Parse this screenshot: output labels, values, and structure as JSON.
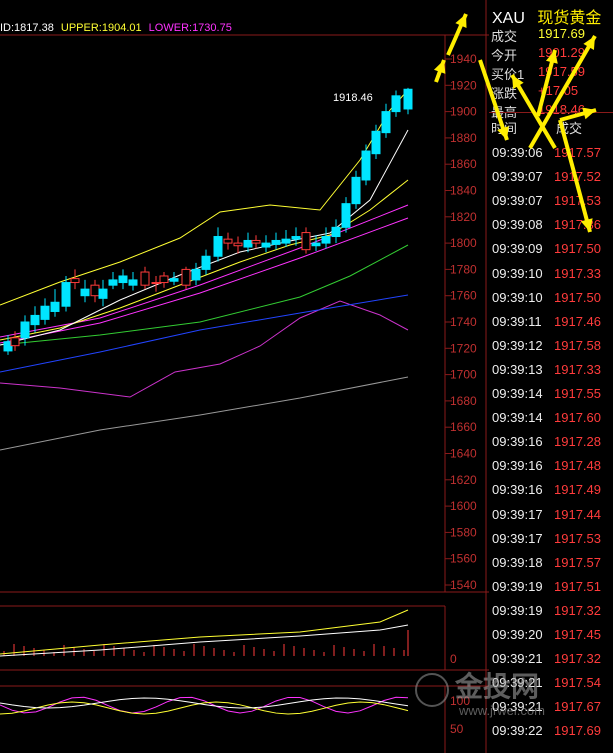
{
  "indicator": {
    "mid": "ID:1817.38",
    "upper": "UPPER:1904.01",
    "lower": "LOWER:1730.75",
    "mid_color": "#ffffff",
    "upper_color": "#ffff33",
    "lower_color": "#ff33ff"
  },
  "price_axis": [
    "1940",
    "1920",
    "1900",
    "1880",
    "1860",
    "1840",
    "1820",
    "1800",
    "1780",
    "1760",
    "1740",
    "1720",
    "1700",
    "1680",
    "1660",
    "1640",
    "1620",
    "1600",
    "1580",
    "1560",
    "1540"
  ],
  "volume_axis": [
    "0"
  ],
  "osc_axis": [
    "100",
    "50"
  ],
  "peak_label": "1918.46",
  "symbol": {
    "code": "XAU",
    "name": "现货黄金"
  },
  "quote": [
    {
      "label": "成交",
      "value": "1917.69",
      "color": "#ffff33"
    },
    {
      "label": "今开",
      "value": "1901.29",
      "color": "#ff3b3b"
    },
    {
      "label": "买价1",
      "value": "1917.59",
      "color": "#ff3b3b"
    },
    {
      "label": "涨跌",
      "value": "+17.05",
      "color": "#ff3b3b"
    },
    {
      "label": "最高",
      "value": "1918.46",
      "color": "#ff3b3b"
    }
  ],
  "ticks_header": {
    "time": "时间",
    "price": "成交"
  },
  "ticks": [
    {
      "time": "09:39:06",
      "price": "1917.57"
    },
    {
      "time": "09:39:07",
      "price": "1917.52"
    },
    {
      "time": "09:39:07",
      "price": "1917.53"
    },
    {
      "time": "09:39:08",
      "price": "1917.36"
    },
    {
      "time": "09:39:09",
      "price": "1917.50"
    },
    {
      "time": "09:39:10",
      "price": "1917.33"
    },
    {
      "time": "09:39:10",
      "price": "1917.50"
    },
    {
      "time": "09:39:11",
      "price": "1917.46"
    },
    {
      "time": "09:39:12",
      "price": "1917.58"
    },
    {
      "time": "09:39:13",
      "price": "1917.33"
    },
    {
      "time": "09:39:14",
      "price": "1917.55"
    },
    {
      "time": "09:39:14",
      "price": "1917.60"
    },
    {
      "time": "09:39:16",
      "price": "1917.28"
    },
    {
      "time": "09:39:16",
      "price": "1917.48"
    },
    {
      "time": "09:39:16",
      "price": "1917.49"
    },
    {
      "time": "09:39:17",
      "price": "1917.44"
    },
    {
      "time": "09:39:17",
      "price": "1917.53"
    },
    {
      "time": "09:39:18",
      "price": "1917.57"
    },
    {
      "time": "09:39:19",
      "price": "1917.51"
    },
    {
      "time": "09:39:19",
      "price": "1917.32"
    },
    {
      "time": "09:39:20",
      "price": "1917.45"
    },
    {
      "time": "09:39:21",
      "price": "1917.32"
    },
    {
      "time": "09:39:21",
      "price": "1917.54"
    },
    {
      "time": "09:39:21",
      "price": "1917.67"
    },
    {
      "time": "09:39:22",
      "price": "1917.69"
    }
  ],
  "watermark": {
    "brand": "金投网",
    "url": "www.jrwei.com"
  },
  "colors": {
    "grid": "#8a1a1a",
    "up": "#ff3b3b",
    "down": "#00e5ff",
    "ma_white": "#ffffff",
    "ma_yellow": "#ffff33",
    "ma_magenta": "#ff33ff",
    "ma_green": "#33cc33",
    "ma_blue": "#2244ff",
    "ma_purple": "#cc33cc",
    "ma_gray": "#999999",
    "arrow": "#ffee00"
  }
}
